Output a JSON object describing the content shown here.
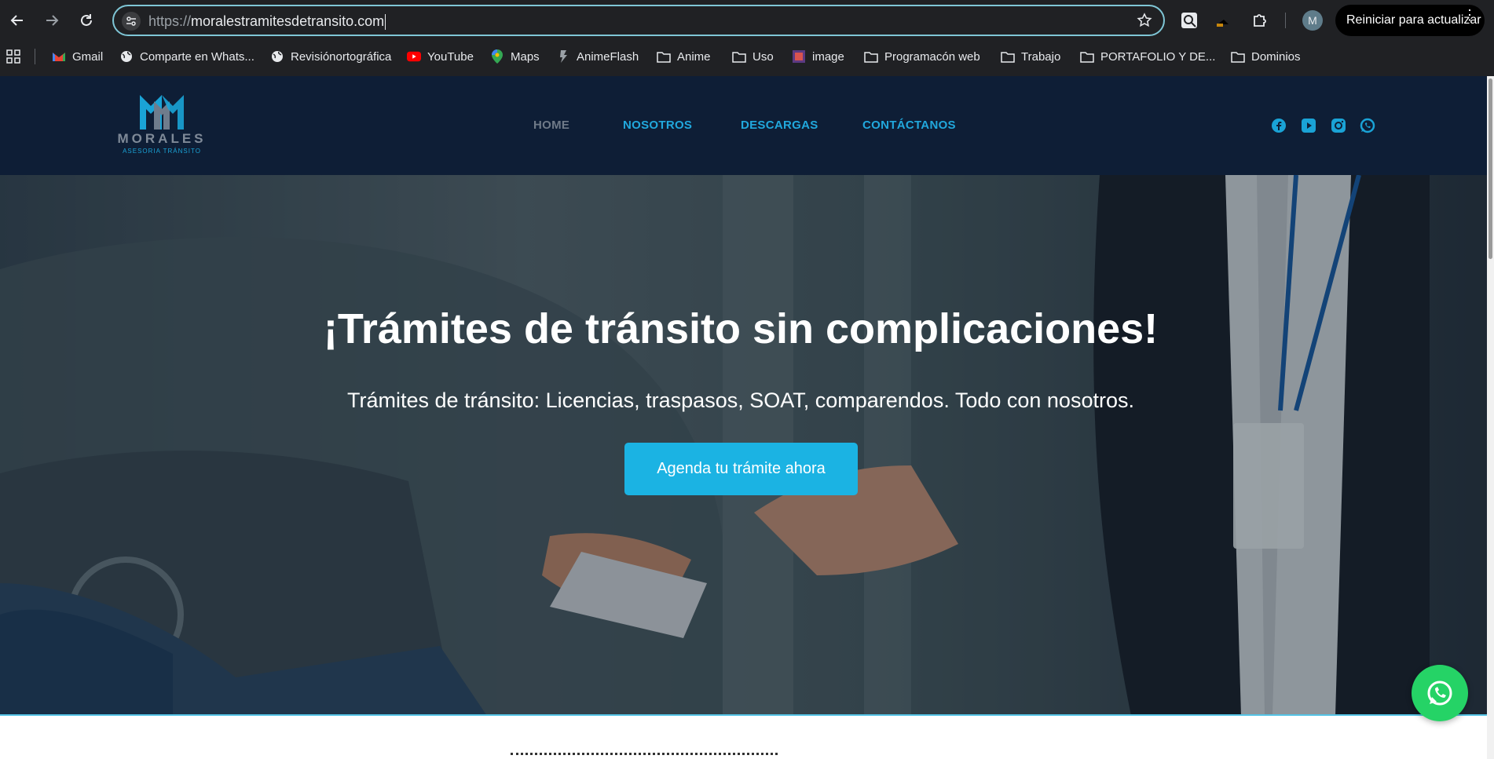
{
  "browser": {
    "url_protocol": "https://",
    "url_host": "moralestramitesdetransito.com",
    "profile_initial": "M",
    "update_button_label": "Reiniciar para actualizar",
    "bookmarks": [
      {
        "label": "Gmail",
        "icon": "gmail-icon"
      },
      {
        "label": "Comparte en Whats...",
        "icon": "globe-icon"
      },
      {
        "label": "Revisiónortográfica",
        "icon": "globe-icon"
      },
      {
        "label": "YouTube",
        "icon": "youtube-icon"
      },
      {
        "label": "Maps",
        "icon": "maps-icon"
      },
      {
        "label": "AnimeFlash",
        "icon": "animeflash-icon"
      },
      {
        "label": "Anime",
        "icon": "folder-icon"
      },
      {
        "label": "Uso",
        "icon": "folder-icon"
      },
      {
        "label": "image",
        "icon": "image-icon"
      },
      {
        "label": "Programacón web",
        "icon": "folder-icon"
      },
      {
        "label": "Trabajo",
        "icon": "folder-icon"
      },
      {
        "label": "PORTAFOLIO Y DE...",
        "icon": "folder-icon"
      },
      {
        "label": "Dominios",
        "icon": "folder-icon"
      }
    ]
  },
  "site": {
    "logo_word": "MORALES",
    "logo_sub": "ASESORIA TRÁNSITO",
    "menu": [
      {
        "label": "HOME",
        "active": true
      },
      {
        "label": "NOSOTROS",
        "active": false
      },
      {
        "label": "DESCARGAS",
        "active": false
      },
      {
        "label": "CONTÁCTANOS",
        "active": false
      }
    ],
    "social": [
      "facebook-icon",
      "youtube-icon",
      "instagram-icon",
      "whatsapp-icon"
    ],
    "accent_color": "#1bb3e3",
    "header_color": "#0e1e36"
  },
  "hero": {
    "title": "¡Trámites de tránsito sin complicaciones!",
    "subtitle": "Trámites de tránsito: Licencias, traspasos, SOAT, comparendos. Todo con nosotros.",
    "cta_label": "Agenda tu trámite ahora"
  }
}
